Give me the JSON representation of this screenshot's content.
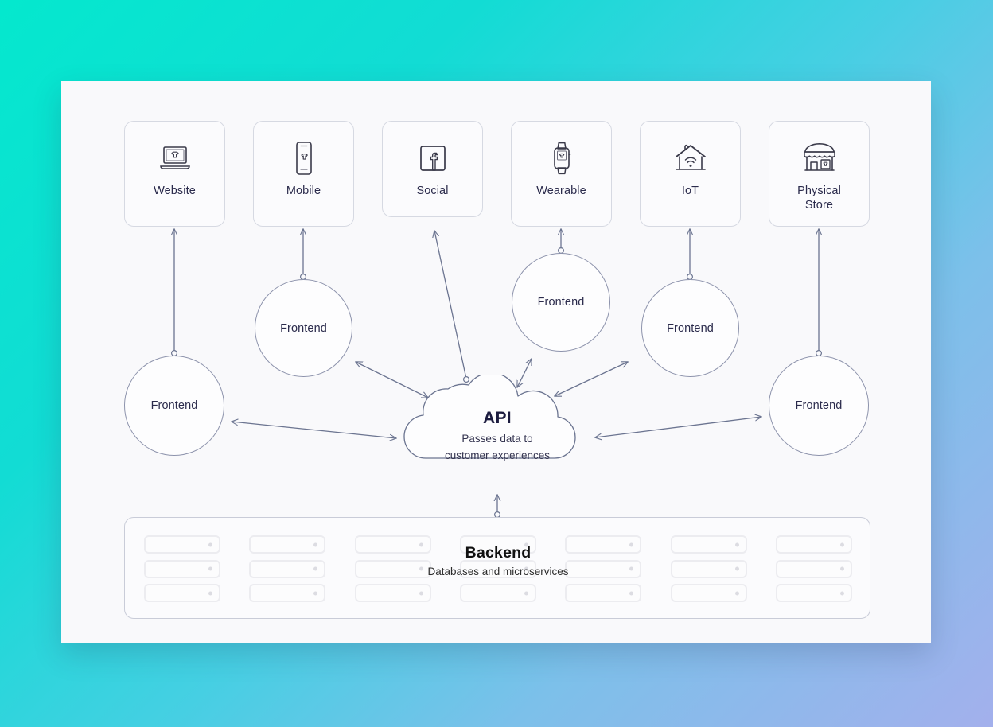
{
  "background": {
    "gradient_from": "#04e8ce",
    "gradient_to": "#a3b0ec"
  },
  "board": {
    "bg": "#f9f9fb"
  },
  "colors": {
    "line": "#6b7490",
    "label_text": "#2b2b4c",
    "card_border": "#d6d9e2"
  },
  "channels": [
    {
      "label": "Website",
      "icon": "laptop-tshirt-icon"
    },
    {
      "label": "Mobile",
      "icon": "phone-tshirt-icon"
    },
    {
      "label": "Social",
      "icon": "facebook-icon"
    },
    {
      "label": "Wearable",
      "icon": "smartwatch-tshirt-icon"
    },
    {
      "label": "IoT",
      "icon": "smart-home-wifi-icon"
    },
    {
      "label": "Physical\nStore",
      "icon": "storefront-icon"
    }
  ],
  "channel_labels": {
    "website": "Website",
    "mobile": "Mobile",
    "social": "Social",
    "wearable": "Wearable",
    "iot": "IoT",
    "physical_store_line1": "Physical",
    "physical_store_line2": "Store"
  },
  "frontends": [
    {
      "label": "Frontend",
      "for": "Website"
    },
    {
      "label": "Frontend",
      "for": "Mobile"
    },
    {
      "label": "Frontend",
      "for": "Wearable"
    },
    {
      "label": "Frontend",
      "for": "IoT"
    },
    {
      "label": "Frontend",
      "for": "Physical Store"
    }
  ],
  "api": {
    "title": "API",
    "subtitle_line1": "Passes data to",
    "subtitle_line2": "customer experiences"
  },
  "backend": {
    "title": "Backend",
    "subtitle": "Databases and microservices",
    "rack_columns": 7,
    "racks_per_column": 3
  }
}
